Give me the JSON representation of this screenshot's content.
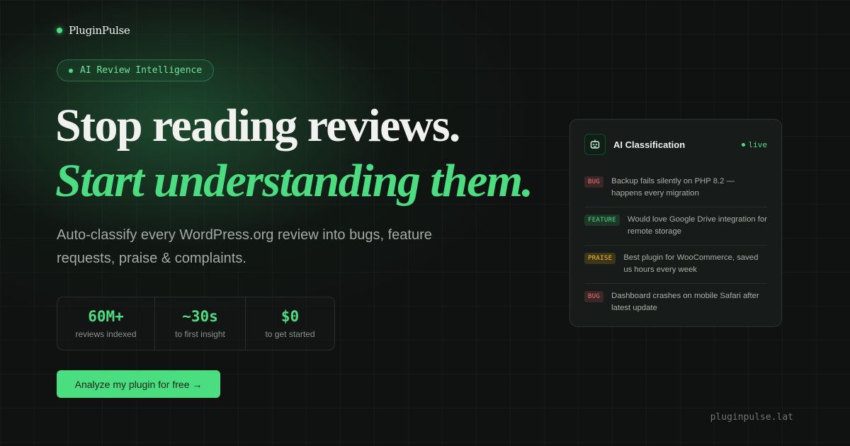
{
  "brand": {
    "name": "PluginPulse",
    "accent": "#4ade80"
  },
  "badge": {
    "text": "AI Review Intelligence"
  },
  "headline": {
    "line1": "Stop reading reviews.",
    "line2": "Start understanding them."
  },
  "subtitle": "Auto-classify every WordPress.org review into bugs, feature requests, praise & complaints.",
  "stats": [
    {
      "value": "60M+",
      "label": "reviews indexed"
    },
    {
      "value": "~30s",
      "label": "to first insight"
    },
    {
      "value": "$0",
      "label": "to get started"
    }
  ],
  "cta": {
    "label": "Analyze my plugin for free →"
  },
  "domain": "pluginpulse.lat",
  "card": {
    "title": "AI Classification",
    "status": "live",
    "reviews": [
      {
        "tag": "BUG",
        "kind": "bug",
        "color": "#f87171",
        "text": "Backup fails silently on PHP 8.2 — happens every migration"
      },
      {
        "tag": "FEATURE",
        "kind": "feature",
        "color": "#4ade80",
        "text": "Would love Google Drive integration for remote storage"
      },
      {
        "tag": "PRAISE",
        "kind": "praise",
        "color": "#fbbf24",
        "text": "Best plugin for WooCommerce, saved us hours every week"
      },
      {
        "tag": "BUG",
        "kind": "bug",
        "color": "#f87171",
        "text": "Dashboard crashes on mobile Safari after latest update"
      }
    ]
  }
}
